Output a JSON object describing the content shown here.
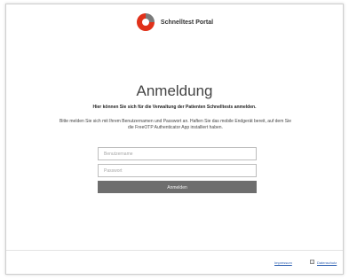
{
  "header": {
    "brand": "Schnelltest Portal",
    "logo_icon": "telekom-logo-icon"
  },
  "main": {
    "title": "Anmeldung",
    "subtitle": "Hier können Sie sich für die Verwaltung der Patienten Schnelltests anmelden.",
    "intro": "Bitte melden Sie sich mit Ihrem Benutzernamen und Passwort an. Haften Sie das mobile Endgerät bereit, auf dem Sie die FreeOTP Authenticator App installiert haben."
  },
  "form": {
    "username_placeholder": "Benutzername",
    "password_placeholder": "Passwort",
    "login_label": "Anmelden"
  },
  "footer": {
    "impressum": "Impressum",
    "datenschutz": "Datenschutz"
  },
  "colors": {
    "accent": "#e0311a",
    "button": "#6e6e6e"
  }
}
